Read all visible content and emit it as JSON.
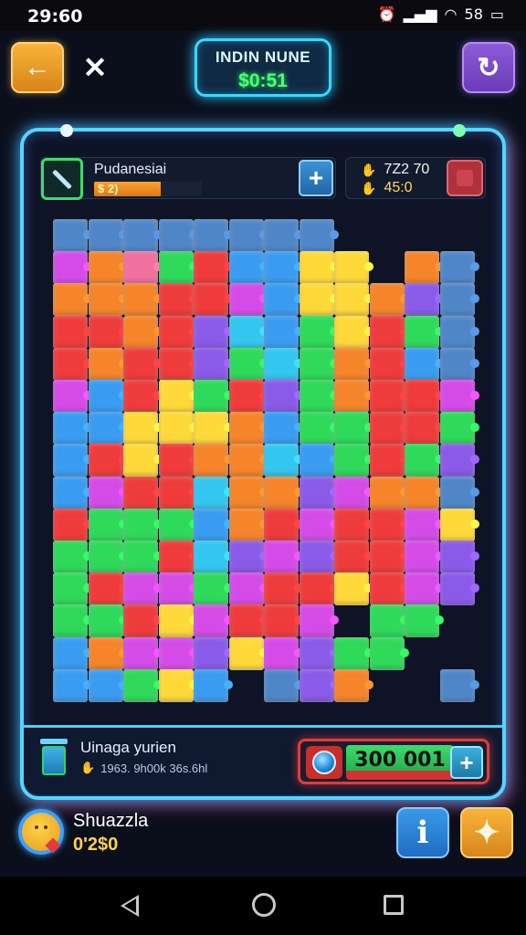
{
  "status_bar": {
    "time": "29:60",
    "right_text": "58",
    "icons": [
      "alarm-icon",
      "signal-icon",
      "wifi-icon",
      "battery-icon"
    ]
  },
  "header": {
    "title": "INDIN NUNE",
    "timer": "$0:51",
    "back_icon": "arrow-left-icon",
    "close_icon": "close-icon",
    "refresh_icon": "refresh-icon"
  },
  "info_panel": {
    "name": "Pudanesiai",
    "progress_label": "$ 2)",
    "progress": 0.62,
    "plus_label": "+",
    "stat_a": "7Z2 70",
    "stat_b": "45:0"
  },
  "puzzle": {
    "colors": {
      "orange": "#f5842a",
      "red": "#ef3b3b",
      "green": "#2fd95a",
      "blue": "#3a9cf0",
      "yellow": "#ffd93a",
      "magenta": "#d54be8",
      "purple": "#8a5ae8",
      "cyan": "#33c6ee",
      "pink": "#f0709e",
      "steel": "#4f86c8"
    },
    "grid": [
      "SSSSSSSS.....",
      "MOKGRBBYY.OS",
      "OOORRMBYYOPS",
      "RRORPCBGYRGS",
      "RORRPGCGORBS",
      "MBRYGRPGORRM",
      "BBYYYOBGGRRG",
      "BRYROOCBGRGP",
      "BMRRCOOPMOOS",
      "RGGGBORMRRMY",
      "GGGRCPMPRRMP",
      "GRMMGMRRYRMP",
      "GGRYMRRM.GG.",
      "BOMMPYMPGG..",
      "BBGYB.SPO..S"
    ]
  },
  "bottom_panel": {
    "title": "Uinaga yurien",
    "subtitle": "1963. 9h00k 36s.6hl",
    "score": "300 001",
    "plus_label": "+"
  },
  "player": {
    "name": "Shuazzla",
    "score": "0'2$0"
  },
  "footer": {
    "info_label": "i",
    "puzzle_icon": "puzzle-icon"
  }
}
